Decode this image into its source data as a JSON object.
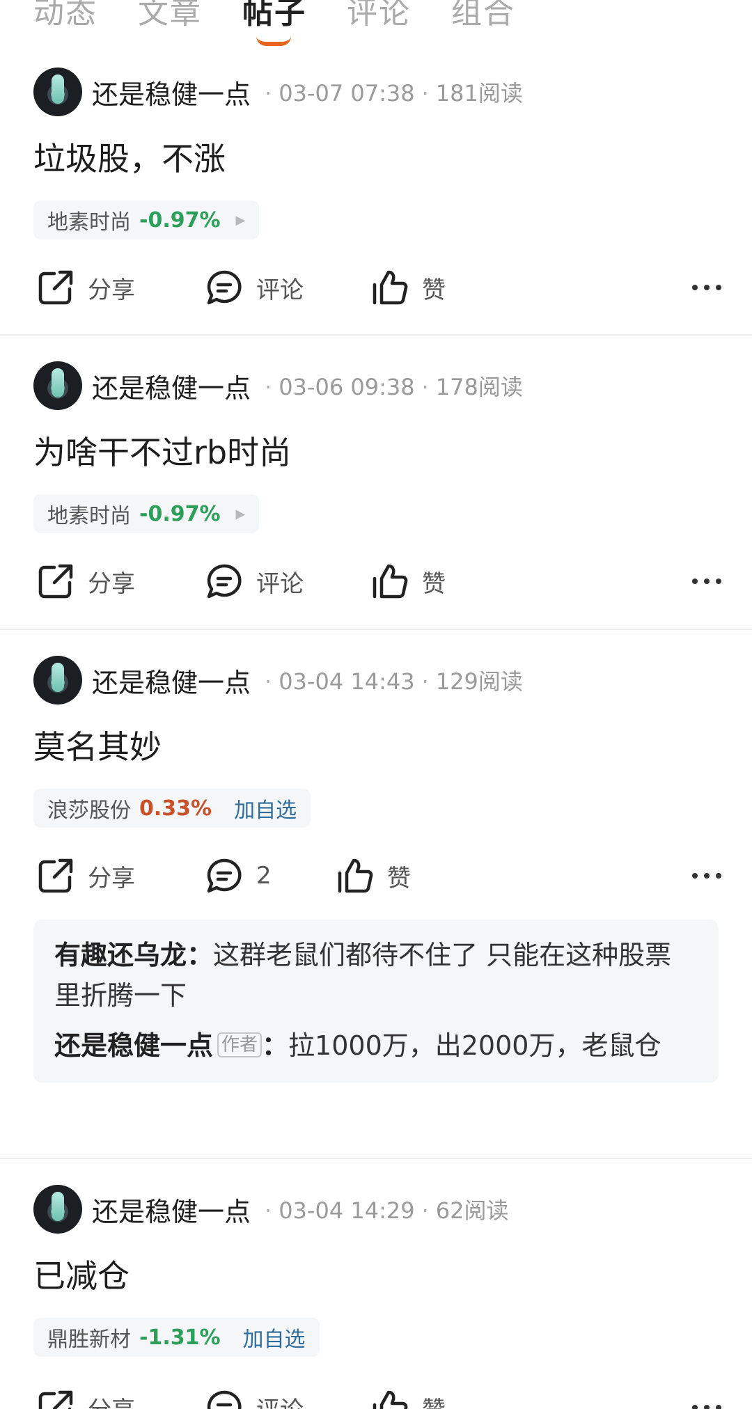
{
  "tabs": [
    "动态",
    "文章",
    "帖子",
    "评论",
    "组合"
  ],
  "active_tab": "帖子",
  "actions": {
    "share": "分享",
    "comment": "评论",
    "like": "赞"
  },
  "posts": [
    {
      "author": "还是稳健一点",
      "date": "03-07 07:38",
      "reads": "181阅读",
      "text": "垃圾股，不涨",
      "stock": {
        "name": "地素时尚",
        "pct": "-0.97%",
        "trend": "down",
        "add": ""
      },
      "comment_label": "评论"
    },
    {
      "author": "还是稳健一点",
      "date": "03-06 09:38",
      "reads": "178阅读",
      "text": "为啥干不过rb时尚",
      "stock": {
        "name": "地素时尚",
        "pct": "-0.97%",
        "trend": "down",
        "add": ""
      },
      "comment_label": "评论"
    },
    {
      "author": "还是稳健一点",
      "date": "03-04 14:43",
      "reads": "129阅读",
      "text": "莫名其妙",
      "stock": {
        "name": "浪莎股份",
        "pct": "0.33%",
        "trend": "up",
        "add": "加自选"
      },
      "comment_label": "2",
      "comments": [
        {
          "name": "有趣还乌龙",
          "badge": "",
          "text": "这群老鼠们都待不住了 只能在这种股票里折腾一下"
        },
        {
          "name": "还是稳健一点",
          "badge": "作者",
          "text": "拉1000万，出2000万，老鼠仓"
        }
      ]
    },
    {
      "author": "还是稳健一点",
      "date": "03-04 14:29",
      "reads": "62阅读",
      "text": "已减仓",
      "stock": {
        "name": "鼎胜新材",
        "pct": "-1.31%",
        "trend": "down",
        "add": "加自选"
      },
      "comment_label": "评论"
    }
  ],
  "colors": {
    "accent": "#e8641e",
    "down": "#2e9e5b",
    "up": "#c9512a",
    "link": "#2f6e9c"
  }
}
